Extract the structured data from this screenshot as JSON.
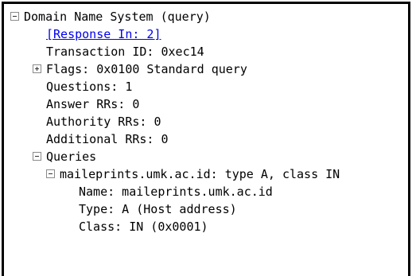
{
  "tree": {
    "root_label": "Domain Name System (query)",
    "response_in": "[Response In: 2]",
    "transaction_id": "Transaction ID: 0xec14",
    "flags": "Flags: 0x0100 Standard query",
    "questions": "Questions: 1",
    "answer_rrs": "Answer RRs: 0",
    "authority_rrs": "Authority RRs: 0",
    "additional_rrs": "Additional RRs: 0",
    "queries": "Queries",
    "query_entry": "maileprints.umk.ac.id: type A, class IN",
    "query_name": "Name: maileprints.umk.ac.id",
    "query_type": "Type: A (Host address)",
    "query_class": "Class: IN (0x0001)"
  },
  "icons": {
    "collapse": "minus-box-icon",
    "expand": "plus-box-icon"
  },
  "colors": {
    "link": "#0000ee",
    "text": "#000000"
  }
}
